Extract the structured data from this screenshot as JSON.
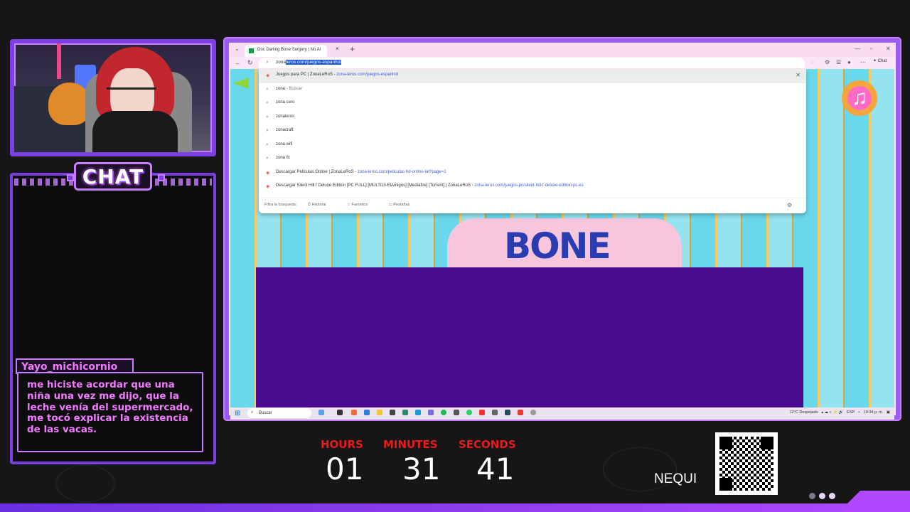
{
  "chat": {
    "title": "CHAT",
    "username": "Yayo_michicornio",
    "message": "me hiciste acordar que una niña una vez me dijo, que la leche venía del supermercado, me tocó explicar la existencia de las vacas."
  },
  "browser": {
    "tab_title": "Doc Darling Bone Surgery | No Ai",
    "address_typed": "zona",
    "address_autocomplete": "leros.com/juegos-espanhol",
    "chat_label": "Chat",
    "suggestions": [
      {
        "icon": "site-icon",
        "title": "Juegos para PC | ZonaLeRoS",
        "url": "zona-leros.com/juegos-espanhol"
      },
      {
        "icon": "search-icon",
        "title": "zona",
        "suffix": " - Buscar"
      },
      {
        "icon": "search-icon",
        "title": "zona cero"
      },
      {
        "icon": "search-icon",
        "title": "zonaleros"
      },
      {
        "icon": "search-icon",
        "title": "zonacraft"
      },
      {
        "icon": "search-icon",
        "title": "zona wifi"
      },
      {
        "icon": "search-icon",
        "title": "zona fit"
      },
      {
        "icon": "site-icon",
        "title": "Descargar Películas Online | ZonaLeRoS",
        "url": "zona-leros.com/peliculas-hd-online-lat?page=1"
      },
      {
        "icon": "site-icon",
        "title": "Descargar Silent Hill f Deluxe Edition [PC FULL] [MULTi13-ElAmigos] [Mediafire] [Torrent] | ZonaLeRoS",
        "url": "zona-leros.com/juegos-pc/silent-hill-f-deluxe-edition-pc-es"
      }
    ],
    "filter_label": "Filtra la búsqueda:",
    "filter_options": [
      "Historial",
      "Favoritos",
      "Pestañas"
    ]
  },
  "game": {
    "logo_text": "BONE"
  },
  "taskbar": {
    "search_placeholder": "Buscar",
    "weather": "12°C  Despejado",
    "lang": "ESP",
    "time": "10:34 p. m."
  },
  "countdown": {
    "hours_label": "HOURS",
    "minutes_label": "MINUTES",
    "seconds_label": "SECONDS",
    "hours": "01",
    "minutes": "31",
    "seconds": "41"
  },
  "donation": {
    "label": "NEQUI"
  },
  "colors": {
    "accent_purple": "#7b3fe4",
    "chat_pink": "#f07bff",
    "countdown_red": "#e81c1c",
    "game_purple": "#4a0a8f"
  }
}
